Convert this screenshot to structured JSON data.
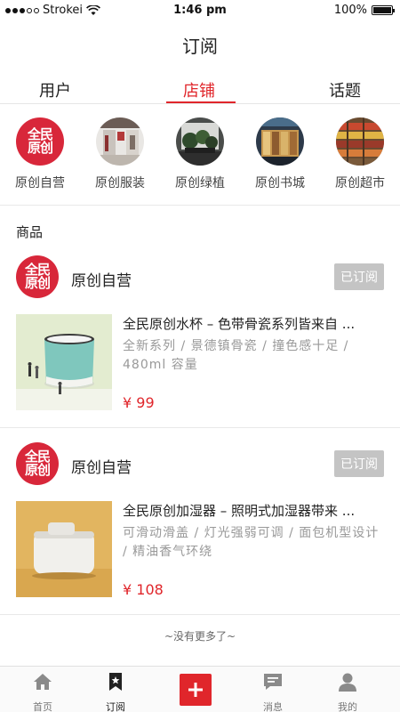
{
  "status_bar": {
    "carrier": "Strokei",
    "time": "1:46 pm",
    "battery": "100%"
  },
  "nav": {
    "title": "订阅"
  },
  "tabs": [
    {
      "label": "用户",
      "active": false
    },
    {
      "label": "店铺",
      "active": true
    },
    {
      "label": "话题",
      "active": false
    }
  ],
  "stores": [
    {
      "name": "原创自营",
      "image": "brand-logo",
      "logo_text": [
        "全民",
        "原创"
      ]
    },
    {
      "name": "原创服装",
      "image": "clothing-store-photo"
    },
    {
      "name": "原创绿植",
      "image": "plant-shop-photo"
    },
    {
      "name": "原创书城",
      "image": "bookstore-photo"
    },
    {
      "name": "原创超市",
      "image": "supermarket-photo"
    }
  ],
  "section": {
    "label": "商品"
  },
  "cards": [
    {
      "shop_name": "原创自营",
      "subscribe_label": "已订阅",
      "product": {
        "title": "全民原创水杯 – 色带骨瓷系列皆来自 ...",
        "desc": "全新系列 / 景德镇骨瓷 / 撞色感十足 / 480ml 容量",
        "price": "¥ 99"
      }
    },
    {
      "shop_name": "原创自营",
      "subscribe_label": "已订阅",
      "product": {
        "title": "全民原创加湿器 – 照明式加湿器带来 ...",
        "desc": "可滑动滑盖 / 灯光强弱可调 / 面包机型设计 / 精油香气环绕",
        "price": "¥ 108"
      }
    }
  ],
  "footer": {
    "no_more": "~没有更多了~"
  },
  "bottom_nav": [
    {
      "label": "首页",
      "icon": "home-icon",
      "active": false
    },
    {
      "label": "订阅",
      "icon": "bookmark-icon",
      "active": true
    },
    {
      "label": "",
      "icon": "plus-icon",
      "active": false
    },
    {
      "label": "消息",
      "icon": "message-icon",
      "active": false
    },
    {
      "label": "我的",
      "icon": "user-icon",
      "active": false
    }
  ],
  "colors": {
    "accent": "#e0262b",
    "brand_logo": "#d8273a",
    "subscribed_button": "#c4c4c4"
  }
}
